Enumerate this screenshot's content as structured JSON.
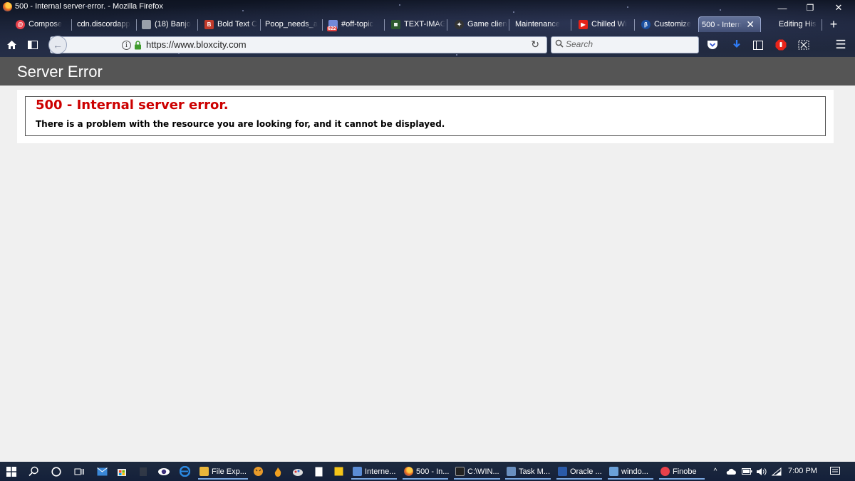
{
  "window": {
    "title": "500 - Internal server error. - Mozilla Firefox",
    "minimize_glyph": "—",
    "restore_glyph": "❐",
    "close_glyph": "✕"
  },
  "tabs": [
    {
      "label": "Compose",
      "icon": "compose-icon",
      "color": "#e8404a"
    },
    {
      "label": "cdn.discordapp",
      "icon": "none",
      "color": ""
    },
    {
      "label": "(18) Banjo",
      "icon": "banjo-icon",
      "color": "#9aa0aa"
    },
    {
      "label": "Bold Text C",
      "icon": "text-icon",
      "color": "#c03a2b"
    },
    {
      "label": "Poop_needs_a",
      "icon": "none",
      "color": ""
    },
    {
      "label": "#off-topic",
      "icon": "discord-icon",
      "color": "#e04040",
      "badge": "622"
    },
    {
      "label": "TEXT-IMAG",
      "icon": "image-icon",
      "color": "#2e5a2e"
    },
    {
      "label": "Game clien",
      "icon": "game-icon",
      "color": "#333333"
    },
    {
      "label": "Maintenance",
      "icon": "none",
      "color": ""
    },
    {
      "label": "Chilled Wi",
      "icon": "youtube-icon",
      "color": "#e62117"
    },
    {
      "label": "Customize",
      "icon": "customize-icon",
      "color": "#1a4fa0"
    },
    {
      "label": "500 - Intern",
      "icon": "none",
      "color": "",
      "active": true
    },
    {
      "label": "Editing His",
      "icon": "none",
      "color": ""
    }
  ],
  "navbar": {
    "url": "https://www.bloxcity.com",
    "search_placeholder": "Search",
    "back_glyph": "←",
    "reload_glyph": "↻",
    "info_glyph": "i",
    "new_tab_glyph": "+",
    "menu_glyph": "☰"
  },
  "page": {
    "header_title": "Server Error",
    "error_heading": "500 - Internal server error.",
    "error_message": "There is a problem with the resource you are looking for, and it cannot be displayed."
  },
  "taskbar": {
    "apps": [
      {
        "label": "File Exp...",
        "color": "#e8b53a"
      },
      {
        "label": "Interne...",
        "color": "#5b8dd6"
      },
      {
        "label": "500 - In...",
        "color": "#e8641f"
      },
      {
        "label": "C:\\WIN...",
        "color": "#222222"
      },
      {
        "label": "Task M...",
        "color": "#6a8fbf"
      },
      {
        "label": "Oracle ...",
        "color": "#2a5aa8"
      },
      {
        "label": "windo...",
        "color": "#6aa0d8"
      },
      {
        "label": "Finobe",
        "color": "#e8404a"
      }
    ],
    "time": "7:00 PM"
  },
  "colors": {
    "page_background": "#f0f0f0",
    "header_background": "#555555",
    "error_red": "#cc0000"
  }
}
